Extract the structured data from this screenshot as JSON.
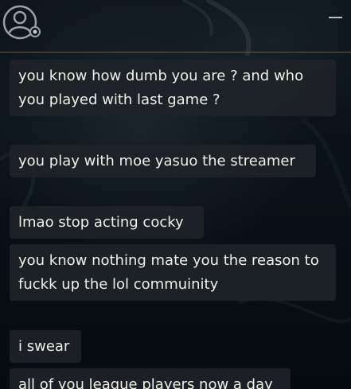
{
  "header": {
    "avatar_icon": "user-avatar-icon",
    "status": "offline",
    "minimize_icon": "minimize-icon"
  },
  "messages": [
    {
      "text": "you know how dumb you are ? and who you played with last game ?"
    },
    {
      "text": "you play with moe yasuo the streamer"
    },
    {
      "text": "lmao stop acting cocky"
    },
    {
      "text": "you know nothing mate you the reason to fuckk up the lol commuinity"
    },
    {
      "text": "i swear"
    },
    {
      "text": "all of you league players now a day"
    }
  ],
  "colors": {
    "background": "#070c12",
    "bubble": "#1e2328",
    "text": "#f0efe8",
    "divider": "#6b5a2e",
    "icon": "#b8bec4"
  }
}
